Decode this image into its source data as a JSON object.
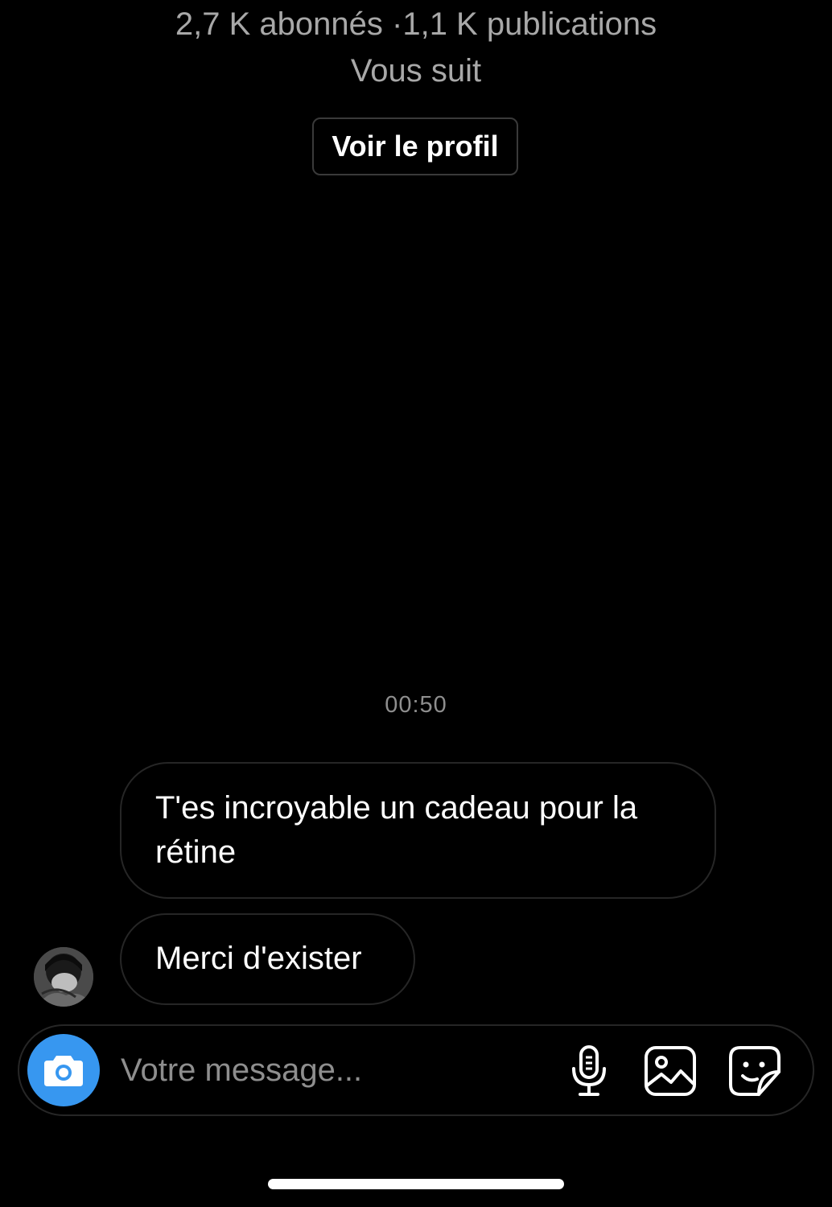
{
  "profile": {
    "stats": "2,7 K abonnés ·1,1 K publications",
    "follow_status": "Vous suit",
    "view_profile_label": "Voir le profil"
  },
  "conversation": {
    "timestamp": "00:50",
    "messages": [
      {
        "text": "T'es incroyable un cadeau pour la rétine"
      },
      {
        "text": "Merci d'exister"
      }
    ]
  },
  "composer": {
    "placeholder": "Votre message...",
    "camera_icon": "camera-icon",
    "mic_icon": "microphone-icon",
    "gallery_icon": "image-icon",
    "sticker_icon": "sticker-icon",
    "accent_color": "#3797f0"
  }
}
